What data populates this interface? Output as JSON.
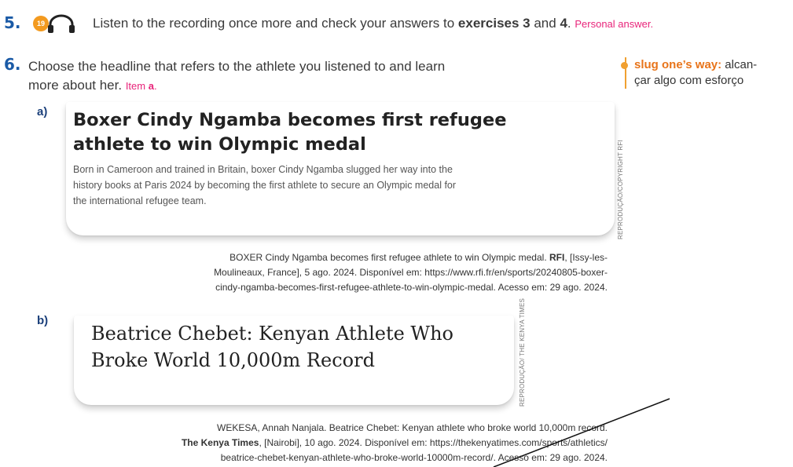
{
  "ex5": {
    "number": "5.",
    "audio_badge": "19",
    "text_a": "Listen to the recording once more and check your answers to ",
    "bold_a": "exercises 3",
    "text_b": " and ",
    "bold_b": "4",
    "text_c": ". ",
    "answer": "Personal answer."
  },
  "ex6": {
    "number": "6.",
    "line1": "Choose the headline that refers to the athlete you listened to and learn",
    "line2": "more about her.",
    "answer_prefix": "Item ",
    "answer_letter": "a",
    "answer_suffix": "."
  },
  "glossary": {
    "term": "slug one’s way:",
    "def_line1": " alcan-",
    "def_line2": "çar algo com esforço"
  },
  "item_a": {
    "letter": "a)",
    "title_line1": "Boxer Cindy Ngamba becomes first refugee",
    "title_line2": "athlete to win Olympic medal",
    "body_line1": "Born in Cameroon and trained in Britain, boxer Cindy Ngamba slugged her way into the",
    "body_line2": "history books at Paris 2024 by becoming the first athlete to secure an Olympic medal for",
    "body_line3": "the international refugee team.",
    "credit": "REPRODUÇÃO/COPYRIGHT RFI",
    "ref_line1_a": "BOXER Cindy Ngamba becomes first refugee athlete to win Olympic medal. ",
    "ref_line1_b": "RFI",
    "ref_line1_c": ", [Issy-les-",
    "ref_line2": "Moulineaux, France], 5 ago. 2024. Disponível em: https://www.rfi.fr/en/sports/20240805-boxer-",
    "ref_line3": "cindy-ngamba-becomes-first-refugee-athlete-to-win-olympic-medal. Acesso em: 29 ago. 2024."
  },
  "item_b": {
    "letter": "b)",
    "title_line1": "Beatrice Chebet: Kenyan Athlete Who",
    "title_line2": "Broke World 10,000m Record",
    "credit_line1": "REPRODUÇÃO/",
    "credit_line2": "THE KENYA TIMES",
    "ref_line1": "WEKESA, Annah Nanjala. Beatrice Chebet: Kenyan athlete who broke world 10,000m record.",
    "ref_line2_a": "The Kenya Times",
    "ref_line2_b": ", [Nairobi], 10 ago. 2024. Disponível em: https://thekenyatimes.com/sports/athletics/",
    "ref_line3": "beatrice-chebet-kenyan-athlete-who-broke-world-10000m-record/. Acesso em: 29 ago. 2024."
  },
  "colors": {
    "number_blue": "#1a5aa6",
    "answer_pink": "#e8247a",
    "glossary_orange": "#f0a030"
  },
  "icons": [
    "headphones-icon",
    "glossary-bullet-icon"
  ]
}
